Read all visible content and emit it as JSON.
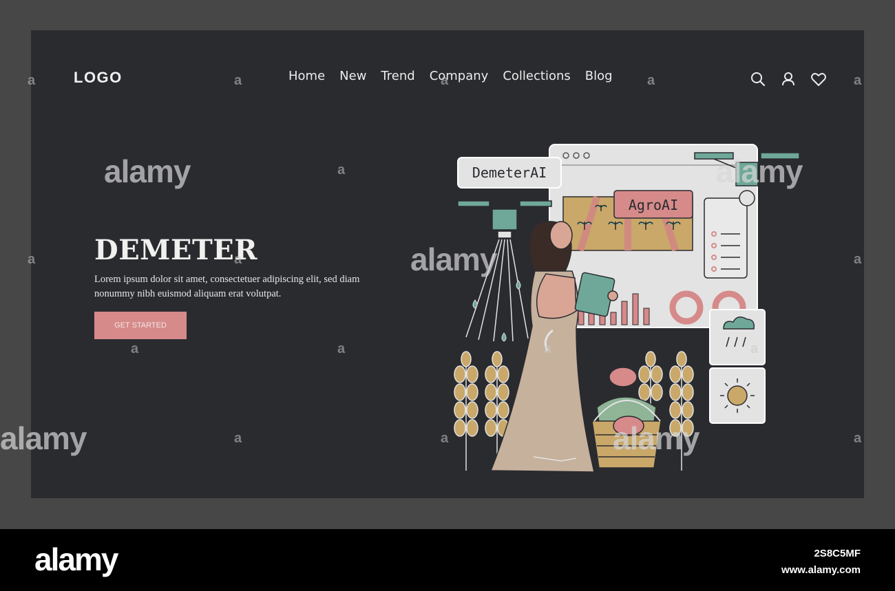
{
  "header": {
    "logo": "LOGO",
    "nav": [
      "Home",
      "New",
      "Trend",
      "Company",
      "Collections",
      "Blog"
    ],
    "icons": [
      "search-icon",
      "user-icon",
      "heart-icon"
    ]
  },
  "hero": {
    "title": "DEMETER",
    "text": "Lorem ipsum dolor sit amet, consectetuer adipiscing elit, sed diam nonummy nibh euismod aliquam erat volutpat.",
    "button": "GET STARTED"
  },
  "illustration": {
    "label_left": "DemeterAI",
    "label_screen": "AgroAI"
  },
  "watermark": {
    "brand": "alamy",
    "small": "a"
  },
  "footer": {
    "brand": "alamy",
    "image_id": "2S8C5MF",
    "site": "www.alamy.com"
  },
  "colors": {
    "page_bg": "#474747",
    "frame_bg": "#2a2b2f",
    "accent_pink": "#d68a8a",
    "accent_teal": "#6fa898",
    "wheat": "#c9a86a"
  }
}
